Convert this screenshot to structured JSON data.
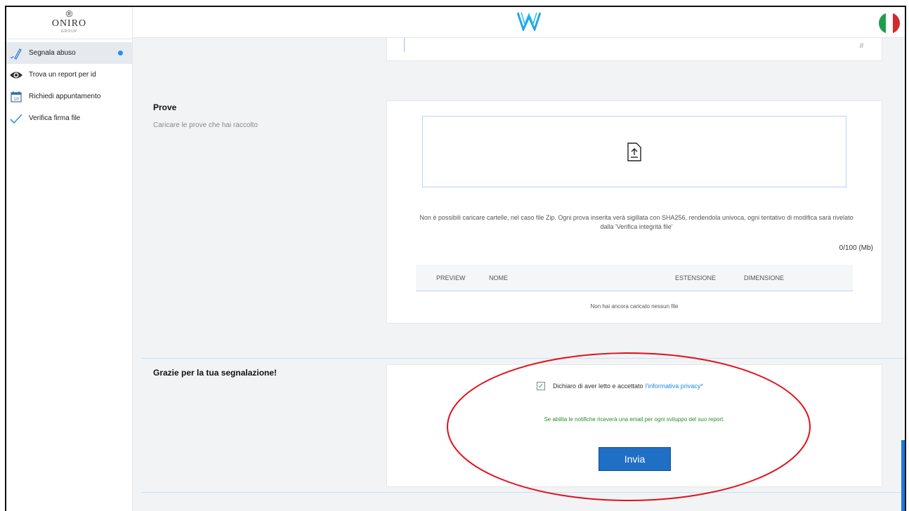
{
  "brand": {
    "mark": "®",
    "name": "ONIRO",
    "sub": "GROUP"
  },
  "sidebar": {
    "items": [
      {
        "label": "Segnala abuso",
        "icon": "signature-icon"
      },
      {
        "label": "Trova un report per id",
        "icon": "eye-icon"
      },
      {
        "label": "Richiedi appuntamento",
        "icon": "calendar-icon"
      },
      {
        "label": "Verifica firma file",
        "icon": "checkmark-icon"
      }
    ]
  },
  "header": {
    "logo": "W",
    "flag_colors": [
      "#1e9e49",
      "#ffffff",
      "#d42a2f"
    ]
  },
  "prove": {
    "title": "Prove",
    "description": "Caricare le prove che hai raccolto",
    "note": "Non è possibili caricare cartelle, nel caso file Zip. Ogni prova inserita verà sigillata con SHA256, rendendola univoca, ogni tentativo di modifica sarà rivelato dalla 'Verifica integrità file'",
    "quota": "0/100 (Mb)",
    "columns": [
      "PREVIEW",
      "NOME",
      "ESTENSIONE",
      "DIMENSIONE"
    ],
    "empty": "Non hai ancora caricato nessun file"
  },
  "submit": {
    "title": "Grazie per la tua segnalazione!",
    "consent_text": "Dichiaro di aver letto e accettato",
    "privacy_link": "l'informativa privacy*",
    "notify_text": "Se abilita le notifiche riceverà una email per ogni sviluppo del suo report.",
    "button": "Invia"
  },
  "colors": {
    "accent": "#1f6fc5",
    "notice": "#2e8b2e",
    "annotation": "#e0101a"
  }
}
